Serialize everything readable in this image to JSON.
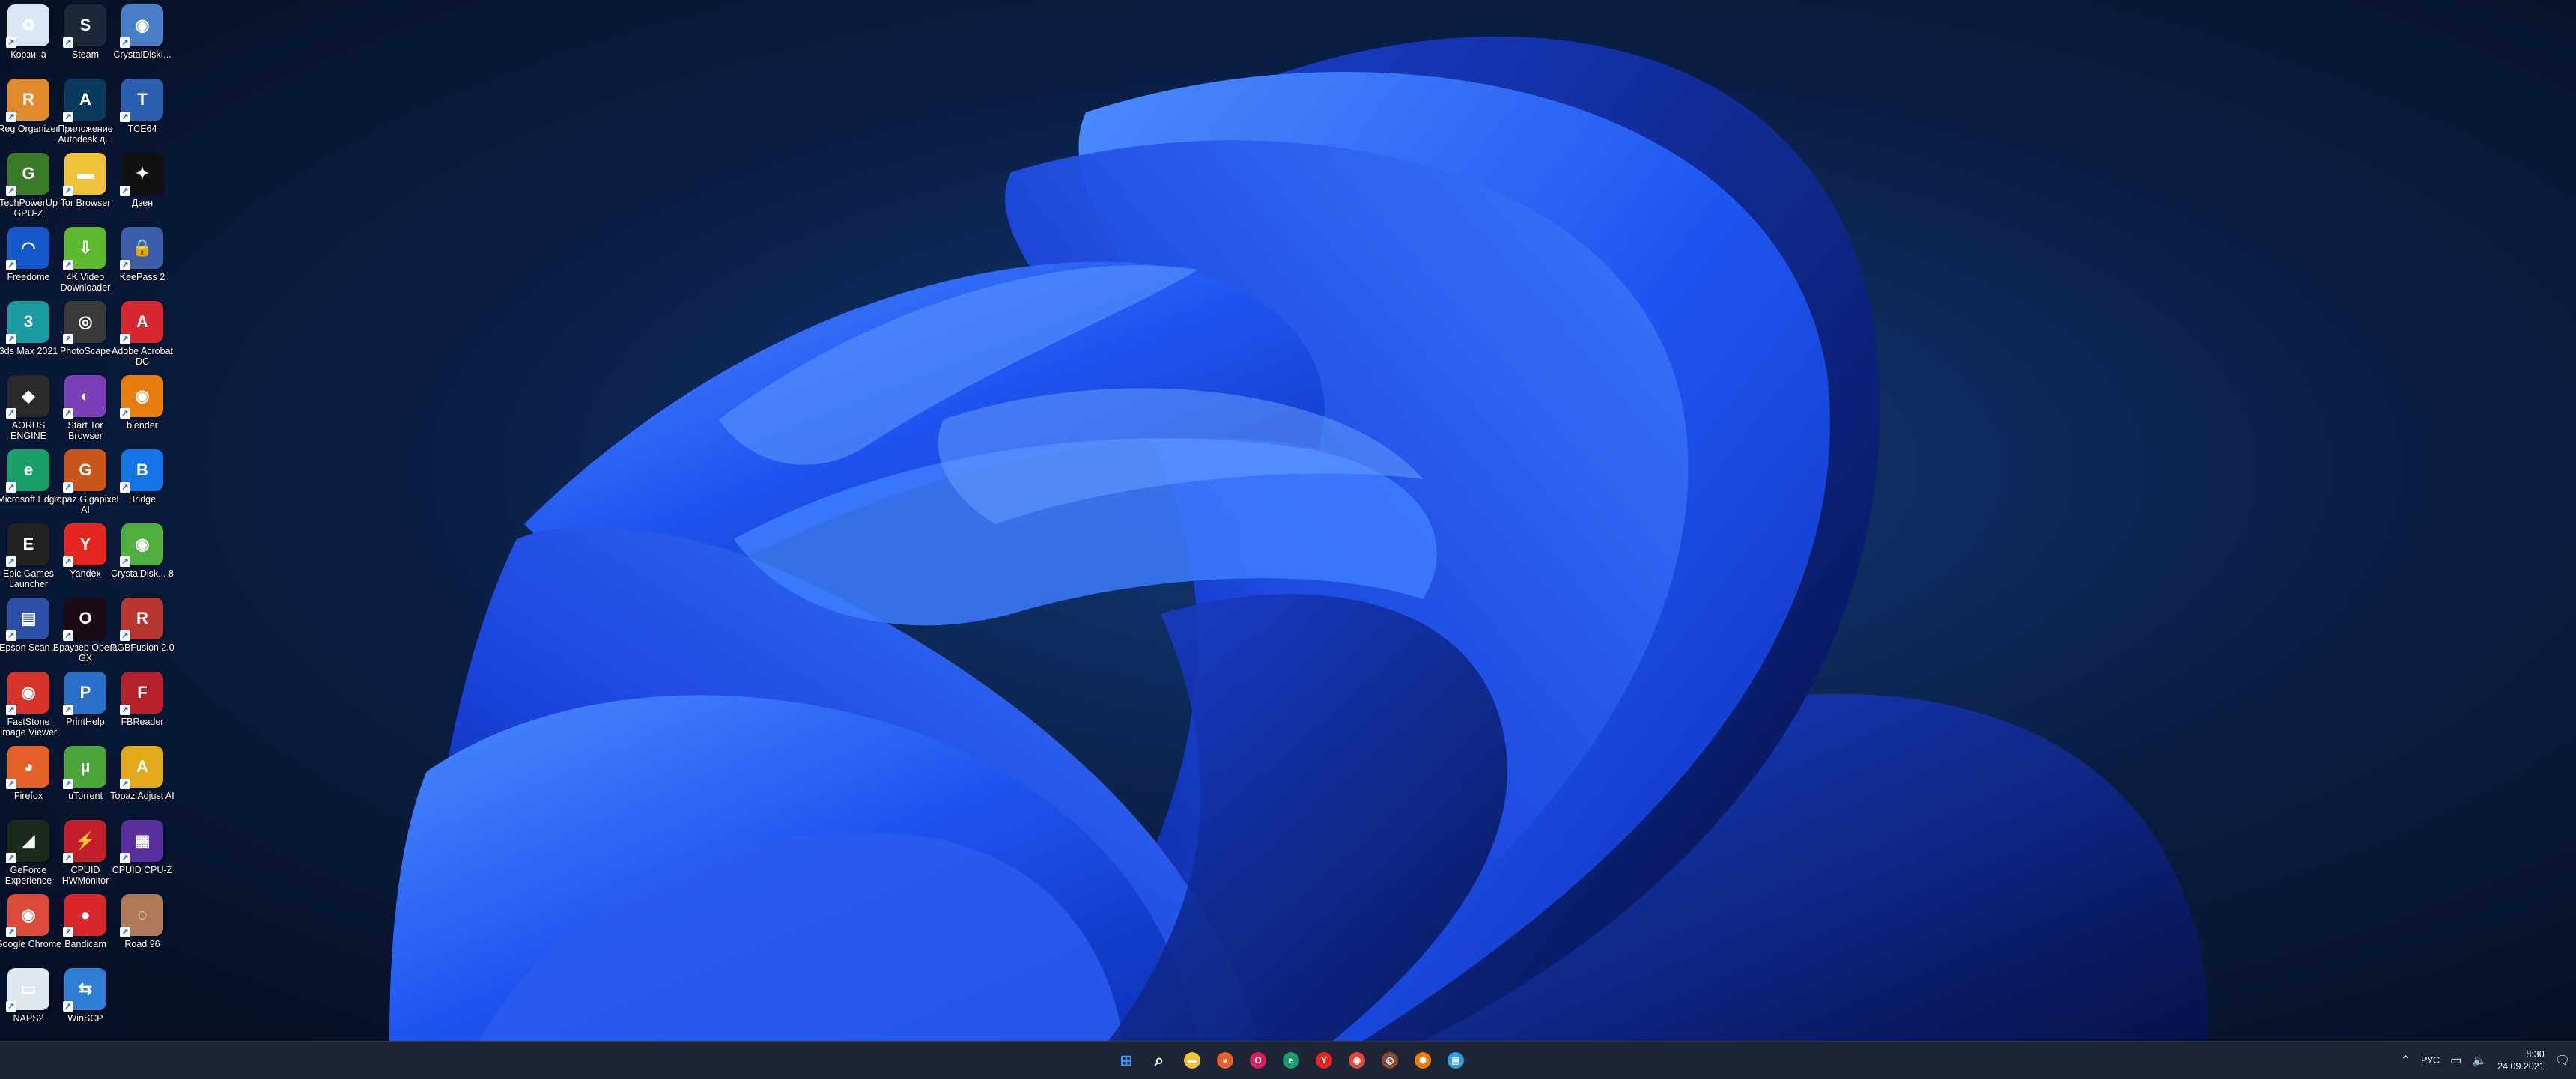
{
  "desktop": {
    "icons": [
      {
        "label": "Корзина",
        "color": "#d9e6f3",
        "symbol": "♻",
        "icon": "recycle-bin-icon"
      },
      {
        "label": "Steam",
        "color": "#1b2838",
        "symbol": "S",
        "icon": "steam-icon"
      },
      {
        "label": "CrystalDiskI...",
        "color": "#4a7fc7",
        "symbol": "◉",
        "icon": "crystaldiskinfo-icon"
      },
      {
        "label": "Reg Organizer",
        "color": "#e08a2c",
        "symbol": "R",
        "icon": "reg-organizer-icon"
      },
      {
        "label": "Приложение Autodesk д...",
        "color": "#0a3a5c",
        "symbol": "A",
        "icon": "autodesk-icon"
      },
      {
        "label": "TCE64",
        "color": "#2d5fb0",
        "symbol": "T",
        "icon": "tce64-icon"
      },
      {
        "label": "TechPowerUp GPU-Z",
        "color": "#3a7a2a",
        "symbol": "G",
        "icon": "gpu-z-icon"
      },
      {
        "label": "Tor Browser",
        "color": "#f0c23a",
        "symbol": "▬",
        "icon": "folder-icon"
      },
      {
        "label": "Дзен",
        "color": "#111111",
        "symbol": "✦",
        "icon": "dzen-icon"
      },
      {
        "label": "Freedome",
        "color": "#1657c9",
        "symbol": "◠",
        "icon": "freedome-icon"
      },
      {
        "label": "4K Video Downloader",
        "color": "#5cb82e",
        "symbol": "⇩",
        "icon": "video-downloader-icon"
      },
      {
        "label": "KeePass 2",
        "color": "#3a5ea8",
        "symbol": "🔒",
        "icon": "keepass-icon"
      },
      {
        "label": "3ds Max 2021",
        "color": "#1a9ba0",
        "symbol": "3",
        "icon": "3ds-max-icon"
      },
      {
        "label": "PhotoScape",
        "color": "#3a3a3a",
        "symbol": "◎",
        "icon": "photoscape-icon"
      },
      {
        "label": "Adobe Acrobat DC",
        "color": "#d7282f",
        "symbol": "A",
        "icon": "acrobat-icon"
      },
      {
        "label": "AORUS ENGINE",
        "color": "#2a2a2a",
        "symbol": "◆",
        "icon": "aorus-icon"
      },
      {
        "label": "Start Tor Browser",
        "color": "#7d3fb8",
        "symbol": "◐",
        "icon": "tor-browser-icon"
      },
      {
        "label": "blender",
        "color": "#e87d0d",
        "symbol": "◉",
        "icon": "blender-icon"
      },
      {
        "label": "Microsoft Edge",
        "color": "#1a9f6b",
        "symbol": "e",
        "icon": "edge-icon"
      },
      {
        "label": "Topaz Gigapixel AI",
        "color": "#c8561a",
        "symbol": "G",
        "icon": "topaz-gigapixel-icon"
      },
      {
        "label": "Bridge",
        "color": "#1473e6",
        "symbol": "B",
        "icon": "bridge-icon"
      },
      {
        "label": "Epic Games Launcher",
        "color": "#222222",
        "symbol": "E",
        "icon": "epic-games-icon"
      },
      {
        "label": "Yandex",
        "color": "#e52620",
        "symbol": "Y",
        "icon": "yandex-icon"
      },
      {
        "label": "CrystalDisk... 8",
        "color": "#4fae3e",
        "symbol": "◉",
        "icon": "crystaldiskmark-icon"
      },
      {
        "label": "Epson Scan 2",
        "color": "#2c4fa8",
        "symbol": "▤",
        "icon": "epson-scan-icon"
      },
      {
        "label": "Браузер Opera GX",
        "color": "#1a0b16",
        "symbol": "O",
        "icon": "opera-gx-icon"
      },
      {
        "label": "RGBFusion 2.0",
        "color": "#b8382f",
        "symbol": "R",
        "icon": "rgbfusion-icon"
      },
      {
        "label": "FastStone Image Viewer",
        "color": "#d6342a",
        "symbol": "◉",
        "icon": "faststone-icon"
      },
      {
        "label": "PrintHelp",
        "color": "#2a6fc7",
        "symbol": "P",
        "icon": "printhelp-icon"
      },
      {
        "label": "FBReader",
        "color": "#b6202a",
        "symbol": "F",
        "icon": "fbreader-icon"
      },
      {
        "label": "Firefox",
        "color": "#e6602a",
        "symbol": "◕",
        "icon": "firefox-icon"
      },
      {
        "label": "uTorrent",
        "color": "#4aa63a",
        "symbol": "µ",
        "icon": "utorrent-icon"
      },
      {
        "label": "Topaz Adjust AI",
        "color": "#e0a91a",
        "symbol": "A",
        "icon": "topaz-adjust-icon"
      },
      {
        "label": "GeForce Experience",
        "color": "#1b2a1a",
        "symbol": "◢",
        "icon": "geforce-icon"
      },
      {
        "label": "CPUID HWMonitor",
        "color": "#c21f2a",
        "symbol": "⚡",
        "icon": "hwmonitor-icon"
      },
      {
        "label": "CPUID CPU-Z",
        "color": "#5a2fa0",
        "symbol": "▦",
        "icon": "cpu-z-icon"
      },
      {
        "label": "Google Chrome",
        "color": "#dd4a3a",
        "symbol": "◉",
        "icon": "chrome-icon"
      },
      {
        "label": "Bandicam",
        "color": "#d8262a",
        "symbol": "●",
        "icon": "bandicam-icon"
      },
      {
        "label": "Road 96",
        "color": "#b07a5a",
        "symbol": "◌",
        "icon": "road96-icon"
      },
      {
        "label": "NAPS2",
        "color": "#dfe6ee",
        "symbol": "▭",
        "icon": "naps2-icon"
      },
      {
        "label": "WinSCP",
        "color": "#2f7fd6",
        "symbol": "⇆",
        "icon": "winscp-icon"
      }
    ]
  },
  "taskbar": {
    "items": [
      {
        "icon": "windows-start-icon",
        "color": "#2f8cff",
        "symbol": "⊞",
        "running": false
      },
      {
        "icon": "search-icon",
        "color": "transparent",
        "symbol": "⌕",
        "running": false
      },
      {
        "icon": "file-explorer-icon",
        "color": "#f0c23a",
        "symbol": "▬",
        "running": false
      },
      {
        "icon": "firefox-icon",
        "color": "#e6602a",
        "symbol": "◕",
        "running": false
      },
      {
        "icon": "opera-gx-icon",
        "color": "#e01e5a",
        "symbol": "O",
        "running": false
      },
      {
        "icon": "edge-icon",
        "color": "#1a9f6b",
        "symbol": "e",
        "running": false
      },
      {
        "icon": "yandex-icon",
        "color": "#e52620",
        "symbol": "Y",
        "running": false
      },
      {
        "icon": "chrome-icon",
        "color": "#dd4a3a",
        "symbol": "◉",
        "running": false
      },
      {
        "icon": "photoscape-icon",
        "color": "#8a4a3a",
        "symbol": "◎",
        "running": false
      },
      {
        "icon": "app-settings-icon",
        "color": "#e87d0d",
        "symbol": "✱",
        "running": false
      },
      {
        "icon": "notepad-icon",
        "color": "#2f9fe0",
        "symbol": "▤",
        "running": false
      }
    ],
    "tray": {
      "language": "РУС",
      "time": "8:30",
      "date": "24.09.2021"
    }
  }
}
